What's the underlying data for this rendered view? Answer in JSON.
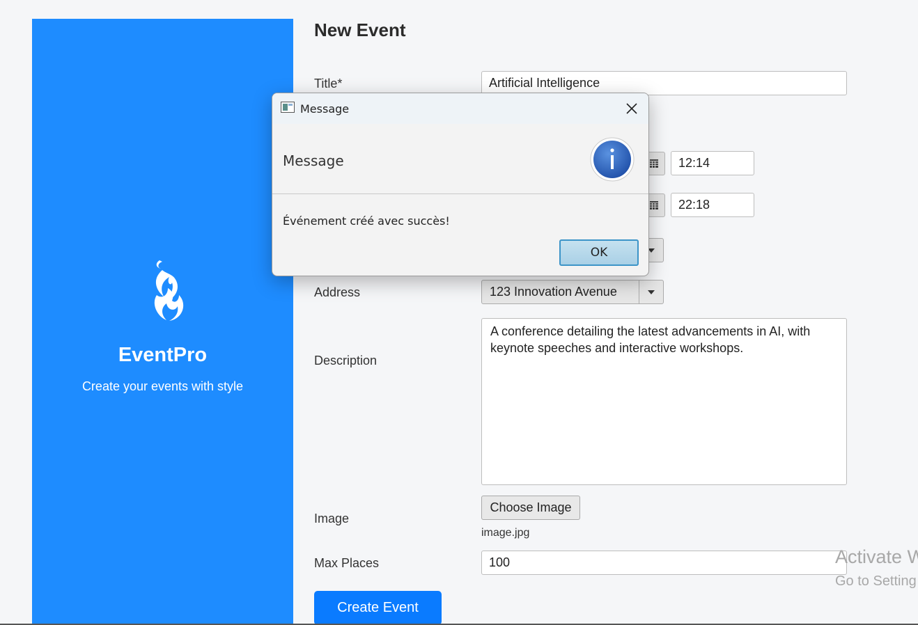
{
  "sidebar": {
    "logo_icon": "flame-logo-icon",
    "brand": "EventPro",
    "tagline": "Create your events with style",
    "bg_color": "#1e8cff"
  },
  "form": {
    "page_title": "New Event",
    "title_label": "Title*",
    "title_value": "Artificial Intelligence",
    "start_time": "12:14",
    "end_time": "22:18",
    "address_label": "Address",
    "address_value": "123 Innovation Avenue",
    "description_label": "Description",
    "description_value": "A conference detailing the latest advancements in AI, with keynote speeches and interactive workshops.",
    "image_label": "Image",
    "choose_image_label": "Choose Image",
    "image_filename": "image.jpg",
    "max_places_label": "Max Places",
    "max_places_value": "100",
    "create_button_label": "Create Event",
    "accent_color": "#0a7bff"
  },
  "dialog": {
    "window_title": "Message",
    "header_text": "Message",
    "content_text": "Événement créé avec succès!",
    "ok_label": "OK",
    "icon": "info-icon",
    "close_icon": "close-icon"
  },
  "watermark": {
    "line1": "Activate W",
    "line2": "Go to Setting"
  }
}
